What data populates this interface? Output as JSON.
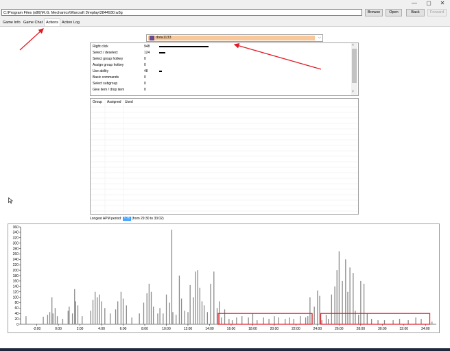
{
  "window": {
    "minimize": "—",
    "maximize": "▢",
    "close": "✕"
  },
  "toolbar": {
    "path": "C:\\Program Files (x86)\\R.G. Mechanics\\Warcraft 3\\replay\\2844930.w3g",
    "browse": "Browse",
    "open": "Open",
    "back": "Back",
    "forward": "Forward"
  },
  "tabs": [
    "Game Info",
    "Game Chat",
    "Actions",
    "Action Log"
  ],
  "active_tab": "Actions",
  "player": {
    "name": "dota1133"
  },
  "actions": [
    {
      "label": "Right click",
      "value": "948",
      "frac": 1.0
    },
    {
      "label": "Select / deselect",
      "value": "124",
      "frac": 0.131
    },
    {
      "label": "Select group hotkey",
      "value": "0",
      "frac": 0
    },
    {
      "label": "Assign group hotkey",
      "value": "0",
      "frac": 0
    },
    {
      "label": "Use ability",
      "value": "48",
      "frac": 0.051
    },
    {
      "label": "Basic commands",
      "value": "0",
      "frac": 0
    },
    {
      "label": "Select subgroup",
      "value": "0",
      "frac": 0
    },
    {
      "label": "Give item / drop item",
      "value": "0",
      "frac": 0
    }
  ],
  "groups_header": [
    "Group",
    "Assigned",
    "Used"
  ],
  "longest": {
    "prefix": "Longest APM period:",
    "value": "3:35",
    "suffix": "(from 29:30 to 33:02)"
  },
  "colors": {
    "bar": "#8a8a8a",
    "annotation": "#e01b24",
    "highlight": "#f8c89a",
    "selection": "#3399ff"
  },
  "chart_data": {
    "type": "bar",
    "title": "",
    "xlabel": "",
    "ylabel": "",
    "xlim": [
      -3.5,
      35
    ],
    "ylim": [
      0,
      360
    ],
    "y_ticks": [
      0,
      20,
      40,
      60,
      80,
      100,
      120,
      140,
      160,
      180,
      200,
      220,
      240,
      260,
      280,
      300,
      320,
      340,
      360
    ],
    "x_ticks": [
      "-2:00",
      "0:00",
      "2:00",
      "4:00",
      "6:00",
      "8:00",
      "10:00",
      "12:00",
      "14:00",
      "16:00",
      "18:00",
      "20:00",
      "22:00",
      "24:00",
      "26:00",
      "28:00",
      "30:00",
      "32:00",
      "34:00"
    ],
    "x_tick_values": [
      -2,
      0,
      2,
      4,
      6,
      8,
      10,
      12,
      14,
      16,
      18,
      20,
      22,
      24,
      26,
      28,
      30,
      32,
      34
    ],
    "bars": [
      [
        -3.0,
        30
      ],
      [
        -1.4,
        28
      ],
      [
        -1.0,
        35
      ],
      [
        -0.8,
        45
      ],
      [
        -0.6,
        100
      ],
      [
        -0.5,
        40
      ],
      [
        -0.3,
        60
      ],
      [
        -0.1,
        30
      ],
      [
        0.4,
        20
      ],
      [
        0.9,
        50
      ],
      [
        1.0,
        65
      ],
      [
        1.3,
        40
      ],
      [
        1.5,
        130
      ],
      [
        1.6,
        85
      ],
      [
        1.8,
        70
      ],
      [
        2.2,
        30
      ],
      [
        3.0,
        50
      ],
      [
        3.2,
        90
      ],
      [
        3.4,
        120
      ],
      [
        3.6,
        100
      ],
      [
        3.8,
        110
      ],
      [
        4.0,
        85
      ],
      [
        4.3,
        60
      ],
      [
        4.8,
        40
      ],
      [
        5.3,
        55
      ],
      [
        5.5,
        85
      ],
      [
        5.8,
        120
      ],
      [
        6.0,
        95
      ],
      [
        6.3,
        70
      ],
      [
        6.8,
        25
      ],
      [
        7.5,
        40
      ],
      [
        7.9,
        80
      ],
      [
        8.2,
        115
      ],
      [
        8.4,
        150
      ],
      [
        8.6,
        120
      ],
      [
        8.8,
        65
      ],
      [
        9.2,
        40
      ],
      [
        9.4,
        60
      ],
      [
        9.7,
        40
      ],
      [
        10.0,
        110
      ],
      [
        10.3,
        80
      ],
      [
        10.5,
        350
      ],
      [
        10.6,
        45
      ],
      [
        10.9,
        35
      ],
      [
        11.2,
        180
      ],
      [
        11.4,
        95
      ],
      [
        11.7,
        50
      ],
      [
        12.0,
        45
      ],
      [
        12.2,
        145
      ],
      [
        12.5,
        100
      ],
      [
        12.7,
        195
      ],
      [
        12.9,
        200
      ],
      [
        13.1,
        135
      ],
      [
        13.3,
        85
      ],
      [
        13.5,
        70
      ],
      [
        13.8,
        45
      ],
      [
        14.1,
        150
      ],
      [
        14.4,
        195
      ],
      [
        14.7,
        60
      ],
      [
        14.9,
        85
      ],
      [
        15.1,
        25
      ],
      [
        15.4,
        55
      ],
      [
        15.8,
        20
      ],
      [
        16.1,
        15
      ],
      [
        16.5,
        25
      ],
      [
        17.0,
        30
      ],
      [
        17.6,
        25
      ],
      [
        18.0,
        40
      ],
      [
        18.4,
        15
      ],
      [
        19.0,
        25
      ],
      [
        19.5,
        20
      ],
      [
        20.0,
        30
      ],
      [
        20.4,
        25
      ],
      [
        21.0,
        20
      ],
      [
        21.4,
        25
      ],
      [
        21.8,
        20
      ],
      [
        22.4,
        30
      ],
      [
        22.9,
        25
      ],
      [
        23.1,
        30
      ],
      [
        23.3,
        100
      ],
      [
        23.5,
        40
      ],
      [
        23.7,
        65
      ],
      [
        24.0,
        125
      ],
      [
        24.2,
        105
      ],
      [
        24.4,
        15
      ],
      [
        24.8,
        35
      ],
      [
        25.0,
        20
      ],
      [
        25.3,
        110
      ],
      [
        25.6,
        140
      ],
      [
        25.8,
        200
      ],
      [
        26.0,
        270
      ],
      [
        26.3,
        160
      ],
      [
        26.6,
        240
      ],
      [
        26.8,
        120
      ],
      [
        27.0,
        210
      ],
      [
        27.3,
        190
      ],
      [
        27.5,
        50
      ],
      [
        27.8,
        35
      ],
      [
        28.0,
        160
      ],
      [
        28.3,
        150
      ],
      [
        28.6,
        40
      ],
      [
        29.0,
        20
      ],
      [
        29.6,
        15
      ],
      [
        30.2,
        15
      ],
      [
        31.0,
        15
      ],
      [
        31.6,
        20
      ],
      [
        32.4,
        15
      ],
      [
        33.1,
        25
      ],
      [
        33.6,
        20
      ],
      [
        34.6,
        10
      ]
    ],
    "annotations": [
      {
        "type": "rect",
        "x_range": [
          14.8,
          23.5
        ],
        "y_range": [
          0,
          40
        ]
      },
      {
        "type": "rect",
        "x_range": [
          24.3,
          34.4
        ],
        "y_range": [
          0,
          40
        ]
      }
    ]
  }
}
